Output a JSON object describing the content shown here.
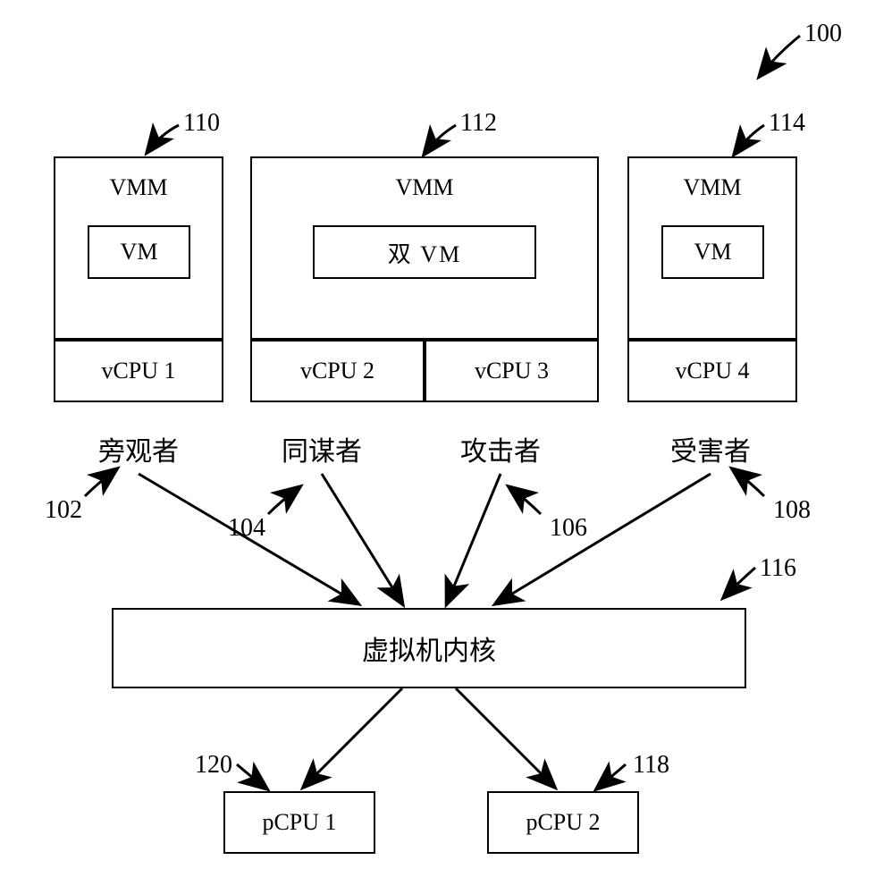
{
  "diagram": {
    "topRef": "100",
    "vmm1": {
      "ref": "110",
      "title": "VMM",
      "inner": "VM",
      "cpu": "vCPU 1"
    },
    "vmm2": {
      "ref": "112",
      "title": "VMM",
      "inner": "双   VM",
      "cpuLeft": "vCPU 2",
      "cpuRight": "vCPU 3"
    },
    "vmm3": {
      "ref": "114",
      "title": "VMM",
      "inner": "VM",
      "cpu": "vCPU 4"
    },
    "roles": {
      "bystander": "旁观者",
      "conspirator": "同谋者",
      "attacker": "攻击者",
      "victim": "受害者"
    },
    "roleRefs": {
      "bystander": "102",
      "conspirator": "104",
      "attacker": "106",
      "victim": "108"
    },
    "kernel": {
      "label": "虚拟机内核",
      "ref": "116"
    },
    "pcpu1": {
      "label": "pCPU 1",
      "ref": "120"
    },
    "pcpu2": {
      "label": "pCPU 2",
      "ref": "118"
    }
  }
}
